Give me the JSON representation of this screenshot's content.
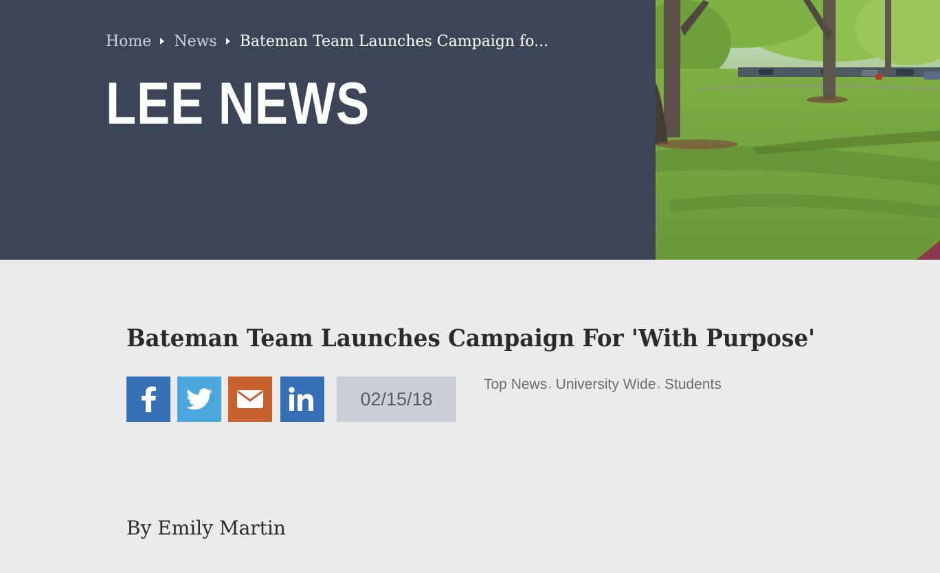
{
  "breadcrumb": {
    "home": "Home",
    "news": "News",
    "current": "Bateman Team Launches Campaign fo..."
  },
  "site": {
    "title": "LEE NEWS"
  },
  "article": {
    "title": "Bateman Team Launches Campaign For 'With Purpose'",
    "date": "02/15/18",
    "byline": "By Emily Martin",
    "tags": [
      "Top News",
      "University Wide",
      "Students"
    ],
    "tag_separator": ","
  },
  "share_buttons": [
    {
      "icon": "facebook-icon",
      "color": "#3671b8"
    },
    {
      "icon": "twitter-icon",
      "color": "#4aa8df"
    },
    {
      "icon": "email-icon",
      "color": "#c9612f"
    },
    {
      "icon": "linkedin-icon",
      "color": "#3671b8"
    }
  ],
  "colors": {
    "hero_background": "#3c4458",
    "page_background": "#ebebeb",
    "date_box": "#cacfd8"
  }
}
